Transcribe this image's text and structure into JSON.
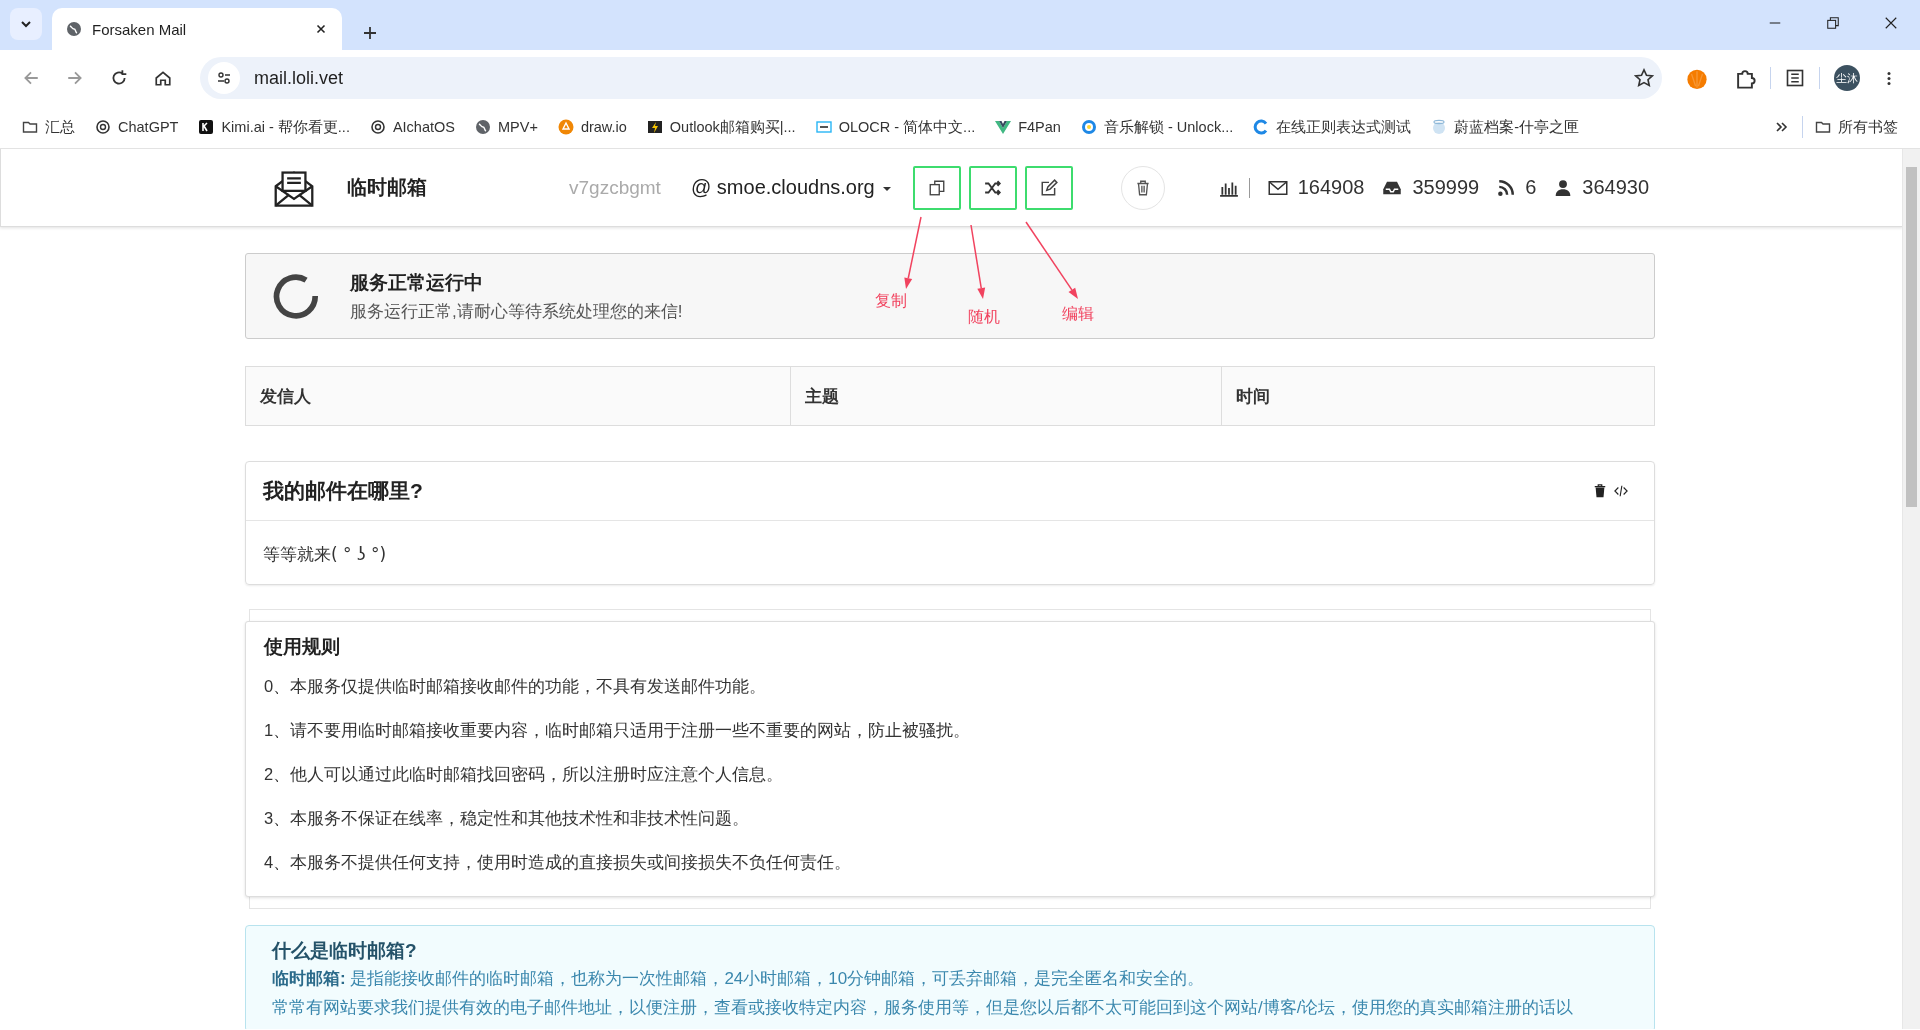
{
  "browser": {
    "tabs": [
      {
        "title": "Forsaken Mail",
        "selected": true
      }
    ],
    "url": "mail.loli.vet",
    "profile": "尘沐",
    "bookmarks": [
      {
        "label": "汇总",
        "kind": "folder"
      },
      {
        "label": "ChatGPT",
        "kind": "knot"
      },
      {
        "label": "Kimi.ai - 帮你看更...",
        "kind": "k"
      },
      {
        "label": "AIchatOS",
        "kind": "knot"
      },
      {
        "label": "MPV+",
        "kind": "globe"
      },
      {
        "label": "draw.io",
        "kind": "orange"
      },
      {
        "label": "Outlook邮箱购买|...",
        "kind": "bolt"
      },
      {
        "label": "OLOCR - 简体中文...",
        "kind": "ocr"
      },
      {
        "label": "F4Pan",
        "kind": "vue"
      },
      {
        "label": "音乐解锁 - Unlock...",
        "kind": "disc"
      },
      {
        "label": "在线正则表达式测试",
        "kind": "c"
      },
      {
        "label": "蔚蓝档案-什亭之匣",
        "kind": "anime"
      }
    ],
    "all_bookmarks": "所有书签"
  },
  "header": {
    "title": "临时邮箱",
    "username": "v7gzcbgmt",
    "domain": "@ smoe.cloudns.org",
    "actions": [
      {
        "kind": "copy",
        "highlighted": true
      },
      {
        "kind": "shuffle",
        "highlighted": true
      },
      {
        "kind": "edit",
        "highlighted": true
      },
      {
        "kind": "trash",
        "highlighted": false
      }
    ],
    "stats": [
      {
        "kind": "mail",
        "value": "164908"
      },
      {
        "kind": "inbox",
        "value": "359999"
      },
      {
        "kind": "rss",
        "value": "6"
      },
      {
        "kind": "user",
        "value": "364930"
      }
    ]
  },
  "annotations": [
    {
      "label": "复制"
    },
    {
      "label": "随机"
    },
    {
      "label": "编辑"
    }
  ],
  "status": {
    "title": "服务正常运行中",
    "message": "服务运行正常,请耐心等待系统处理您的来信!"
  },
  "table": {
    "columns": [
      "发信人",
      "主题",
      "时间"
    ]
  },
  "mail_card": {
    "title": "我的邮件在哪里?",
    "body": "等等就来( ° ʖ °)"
  },
  "rules": {
    "title": "使用规则",
    "items": [
      "0、本服务仅提供临时邮箱接收邮件的功能，不具有发送邮件功能。",
      "1、请不要用临时邮箱接收重要内容，临时邮箱只适用于注册一些不重要的网站，防止被骚扰。",
      "2、他人可以通过此临时邮箱找回密码，所以注册时应注意个人信息。",
      "3、本服务不保证在线率，稳定性和其他技术性和非技术性问题。",
      "4、本服务不提供任何支持，使用时造成的直接损失或间接损失不负任何责任。"
    ]
  },
  "info": {
    "title": "什么是临时邮箱?",
    "intro": "**临时邮箱:** 是指能接收邮件的临时邮箱，也称为一次性邮箱，24小时邮箱，10分钟邮箱，可丢弃邮箱，是完全匿名和安全的。",
    "text": "常常有网站要求我们提供有效的电子邮件地址，以便注册，查看或接收特定内容，服务使用等，但是您以后都不太可能回到这个网站/博客/论坛，使用您的真实邮箱注册的话以"
  }
}
